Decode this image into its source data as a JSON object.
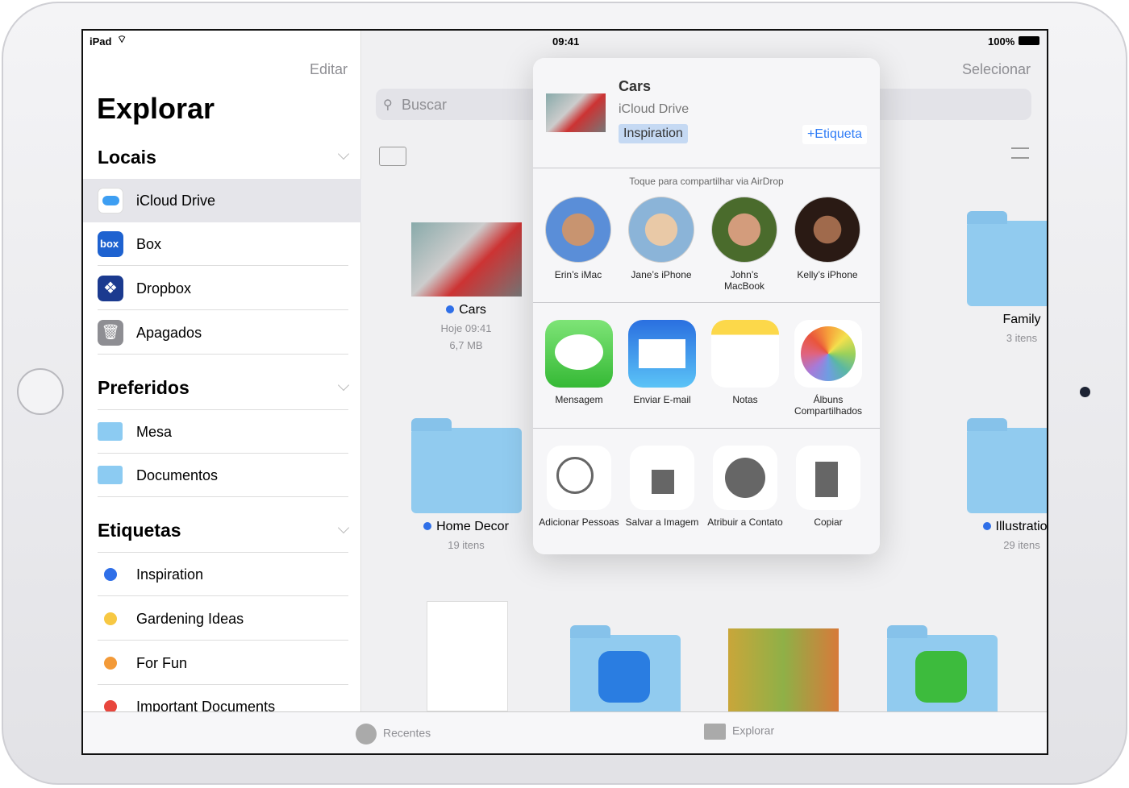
{
  "status": {
    "device": "iPad",
    "time": "09:41",
    "battery": "100%"
  },
  "sidebar": {
    "edit": "Editar",
    "title": "Explorar",
    "locations_title": "Locais",
    "locations": [
      {
        "label": "iCloud Drive"
      },
      {
        "label": "Box"
      },
      {
        "label": "Dropbox"
      },
      {
        "label": "Apagados"
      }
    ],
    "favorites_title": "Preferidos",
    "favorites": [
      {
        "label": "Mesa"
      },
      {
        "label": "Documentos"
      }
    ],
    "tags_title": "Etiquetas",
    "tags": [
      {
        "label": "Inspiration",
        "color": "#2f6fe8"
      },
      {
        "label": "Gardening Ideas",
        "color": "#f7c843"
      },
      {
        "label": "For Fun",
        "color": "#f39a38"
      },
      {
        "label": "Important Documents",
        "color": "#e8463d"
      }
    ]
  },
  "main": {
    "select": "Selecionar",
    "search_placeholder": "Buscar",
    "items": [
      {
        "name": "Cars",
        "line1": "Hoje 09:41",
        "line2": "6,7 MB"
      },
      {
        "name": "Family",
        "line1": "3 itens"
      },
      {
        "name": "Home Decor",
        "line1": "19 itens"
      },
      {
        "name": "Illustrations",
        "line1": "29 itens"
      }
    ]
  },
  "share": {
    "file_name": "Cars",
    "location": "iCloud Drive",
    "tag": "Inspiration",
    "add_tag": "+Etiqueta",
    "airdrop_hint": "Toque para compartilhar via AirDrop",
    "people": [
      {
        "name": "Erin’s iMac"
      },
      {
        "name": "Jane’s iPhone"
      },
      {
        "name": "John’s MacBook"
      },
      {
        "name": "Kelly’s iPhone"
      }
    ],
    "apps": [
      {
        "label": "Mensagem"
      },
      {
        "label": "Enviar E-mail"
      },
      {
        "label": "Notas"
      },
      {
        "label": "Álbuns Compartilhados"
      }
    ],
    "actions": [
      {
        "label": "Adicionar Pessoas"
      },
      {
        "label": "Salvar a Imagem"
      },
      {
        "label": "Atribuir a Contato"
      },
      {
        "label": "Copiar"
      }
    ]
  },
  "tabbar": {
    "recents": "Recentes",
    "browse": "Explorar"
  }
}
